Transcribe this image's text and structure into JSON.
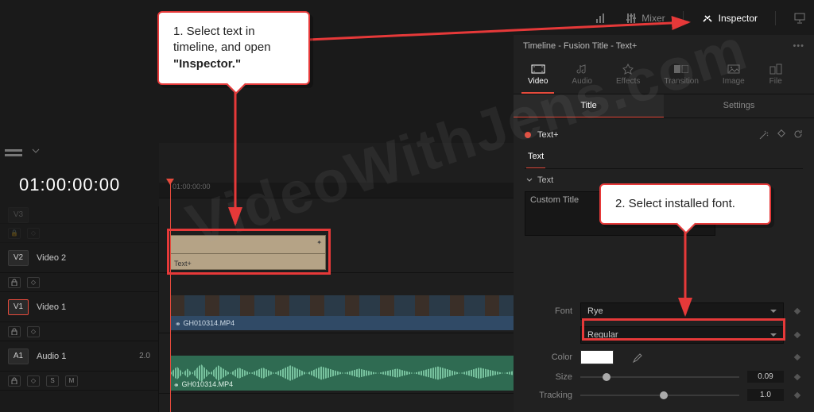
{
  "topbar": {
    "mixer": "Mixer",
    "inspector": "Inspector"
  },
  "inspector": {
    "header": "Timeline - Fusion Title - Text+",
    "tabs1": {
      "video": "Video",
      "audio": "Audio",
      "effects": "Effects",
      "transition": "Transition",
      "image": "Image",
      "file": "File"
    },
    "tabs2": {
      "title": "Title",
      "settings": "Settings"
    },
    "node": "Text+",
    "tabs3": {
      "text": "Text"
    },
    "section_text": "Text",
    "textarea_value": "Custom Title",
    "props": {
      "font_label": "Font",
      "font_value": "Rye",
      "weight_value": "Regular",
      "color_label": "Color",
      "size_label": "Size",
      "size_value": "0.09",
      "tracking_label": "Tracking",
      "tracking_value": "1.0"
    }
  },
  "timeline": {
    "timecode": "01:00:00:00",
    "ruler_start": "01:00:00:00",
    "tracks": {
      "v2": "Video 2",
      "v1": "Video 1",
      "a1": "Audio 1",
      "v2_badge": "V2",
      "v1_badge": "V1",
      "a1_badge": "A1",
      "a1_level": "2.0",
      "ctrl_s": "S",
      "ctrl_m": "M"
    },
    "clips": {
      "text_label": "Text+",
      "video_file": "GH010314.MP4",
      "audio_file": "GH010314.MP4"
    }
  },
  "callouts": {
    "c1_line1": "1. Select text in",
    "c1_line2": "timeline, and open",
    "c1_bold": "\"Inspector.\"",
    "c2": "2. Select installed font."
  },
  "watermark": "VideoWithJens.com"
}
